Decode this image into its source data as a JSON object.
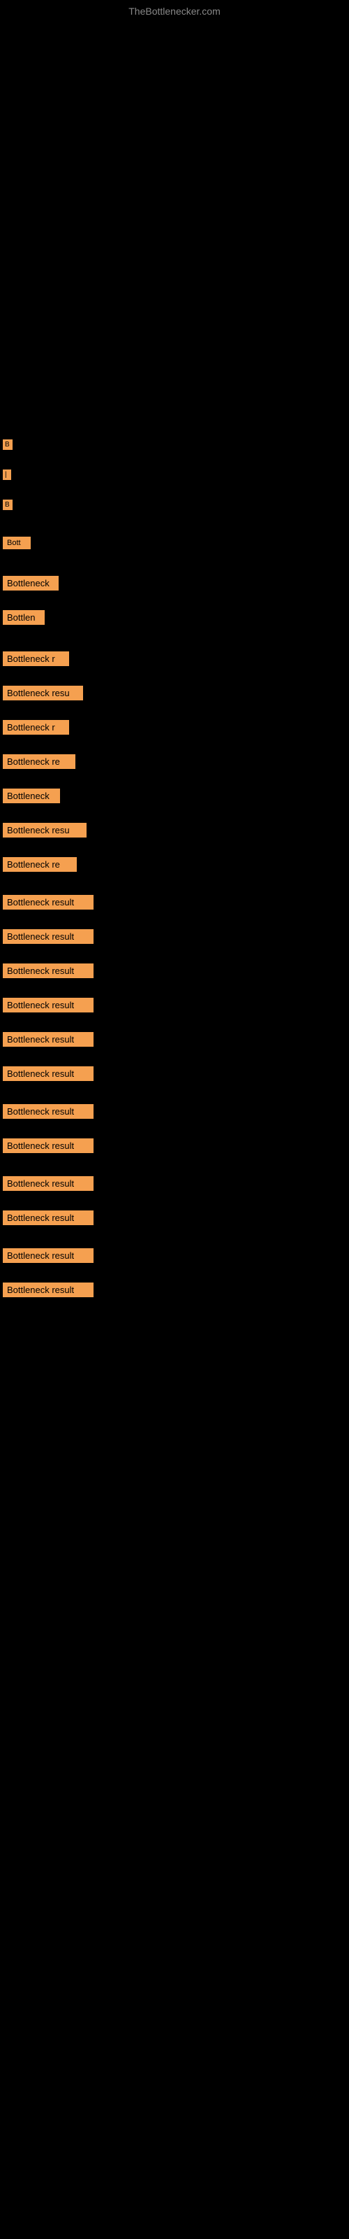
{
  "site": {
    "title": "TheBottlenecker.com"
  },
  "items": [
    {
      "id": 1,
      "label": "B",
      "width": 14
    },
    {
      "id": 2,
      "label": "|",
      "width": 10
    },
    {
      "id": 3,
      "label": "B",
      "width": 14
    },
    {
      "id": 4,
      "label": "Bott",
      "width": 38
    },
    {
      "id": 5,
      "label": "Bottleneck",
      "width": 80
    },
    {
      "id": 6,
      "label": "Bottlen",
      "width": 58
    },
    {
      "id": 7,
      "label": "Bottleneck r",
      "width": 92
    },
    {
      "id": 8,
      "label": "Bottleneck resu",
      "width": 112
    },
    {
      "id": 9,
      "label": "Bottleneck r",
      "width": 92
    },
    {
      "id": 10,
      "label": "Bottleneck re",
      "width": 100
    },
    {
      "id": 11,
      "label": "Bottleneck",
      "width": 80
    },
    {
      "id": 12,
      "label": "Bottleneck resu",
      "width": 120
    },
    {
      "id": 13,
      "label": "Bottleneck re",
      "width": 104
    },
    {
      "id": 14,
      "label": "Bottleneck result",
      "width": 128
    },
    {
      "id": 15,
      "label": "Bottleneck result",
      "width": 128
    },
    {
      "id": 16,
      "label": "Bottleneck result",
      "width": 128
    },
    {
      "id": 17,
      "label": "Bottleneck result",
      "width": 128
    },
    {
      "id": 18,
      "label": "Bottleneck result",
      "width": 128
    },
    {
      "id": 19,
      "label": "Bottleneck result",
      "width": 128
    },
    {
      "id": 20,
      "label": "Bottleneck result",
      "width": 128
    },
    {
      "id": 21,
      "label": "Bottleneck result",
      "width": 128
    },
    {
      "id": 22,
      "label": "Bottleneck result",
      "width": 128
    },
    {
      "id": 23,
      "label": "Bottleneck result",
      "width": 128
    },
    {
      "id": 24,
      "label": "Bottleneck result",
      "width": 128
    },
    {
      "id": 25,
      "label": "Bottleneck result",
      "width": 128
    }
  ],
  "colors": {
    "background": "#000000",
    "item_bg": "#f5a050",
    "item_text": "#000000",
    "title": "#888888"
  }
}
